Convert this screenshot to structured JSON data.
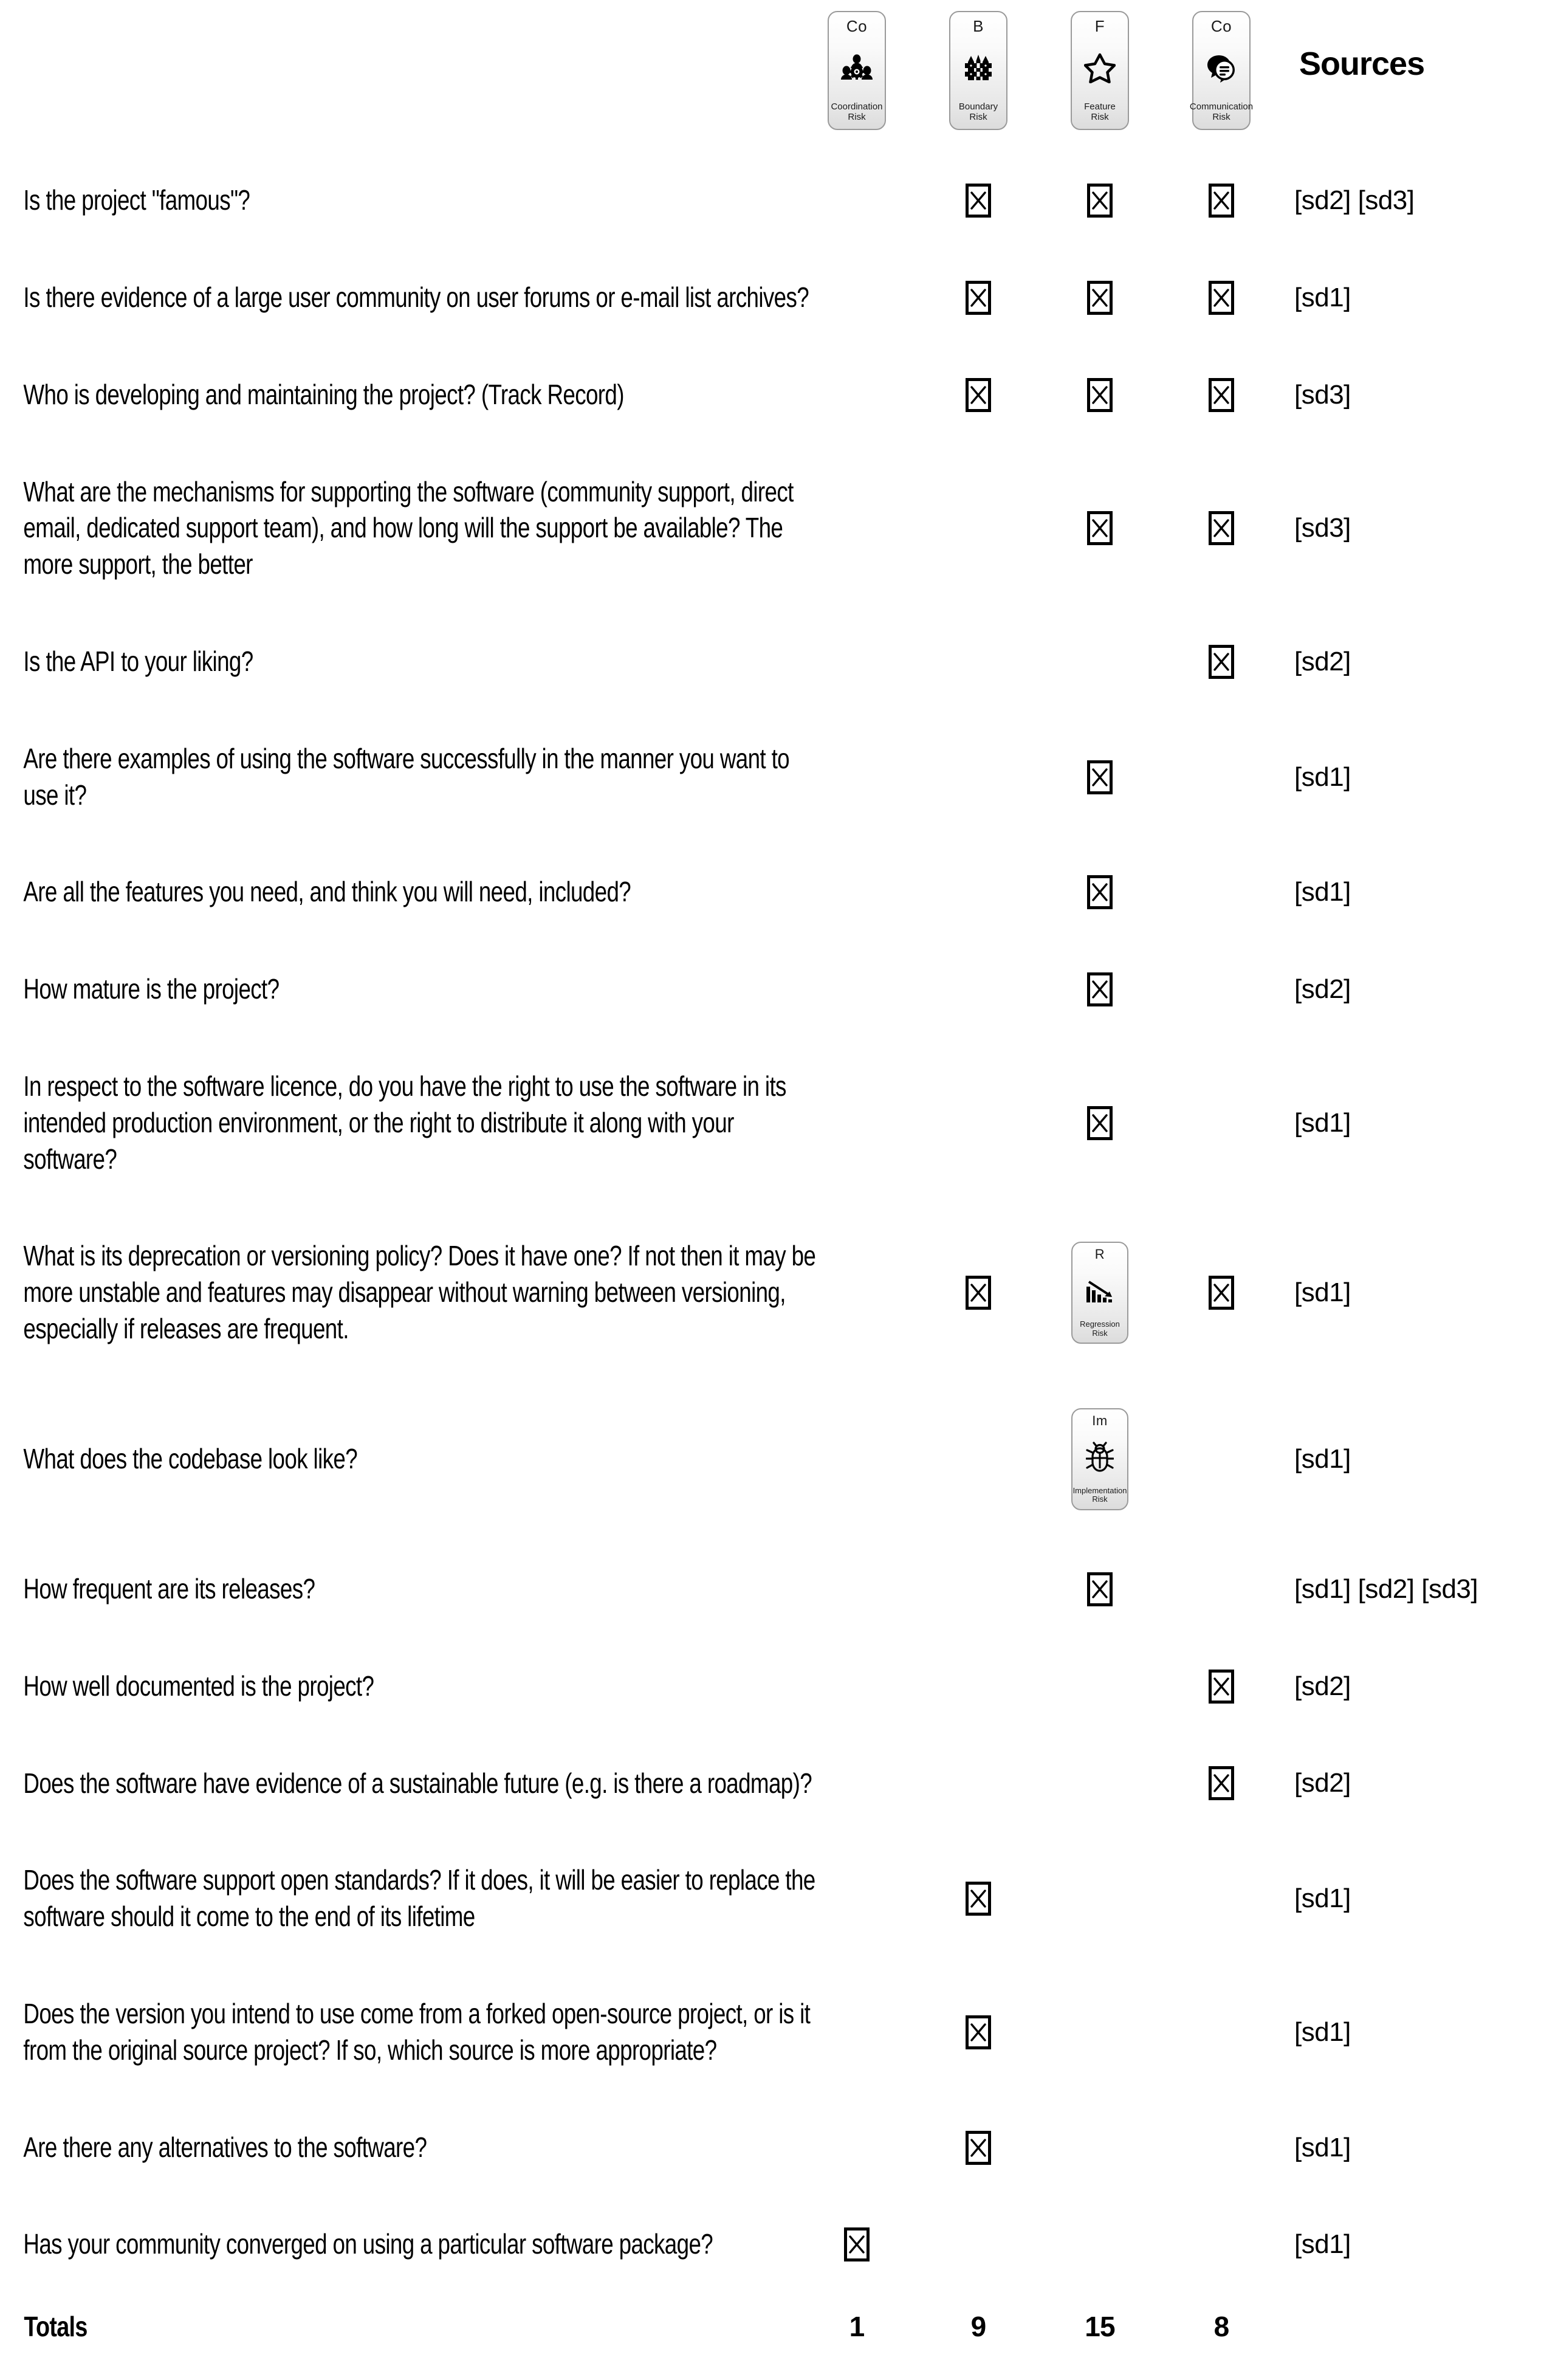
{
  "header": {
    "sources_label": "Sources",
    "risk_columns": [
      {
        "code": "Co",
        "label": "Coordination\nRisk",
        "icon": "people-gear-icon"
      },
      {
        "code": "B",
        "label": "Boundary\nRisk",
        "icon": "fence-icon"
      },
      {
        "code": "F",
        "label": "Feature\nRisk",
        "icon": "star-icon"
      },
      {
        "code": "Co",
        "label": "Communication\nRisk",
        "icon": "speech-bubble-icon"
      }
    ]
  },
  "inline_badges": {
    "regression": {
      "code": "R",
      "label": "Regression\nRisk",
      "icon": "declining-bar-chart-icon"
    },
    "implementation": {
      "code": "Im",
      "label": "Implementation\nRisk",
      "icon": "bug-icon"
    }
  },
  "rows": [
    {
      "question": "Is the project \"famous\"?",
      "marks": [
        "",
        "x",
        "x",
        "x"
      ],
      "sources": "[sd2] [sd3]"
    },
    {
      "question": "Is there evidence of a large user community on user forums or e-mail list archives?",
      "marks": [
        "",
        "x",
        "x",
        "x"
      ],
      "sources": "[sd1]"
    },
    {
      "question": "Who is developing and maintaining the project? (Track Record)",
      "marks": [
        "",
        "x",
        "x",
        "x"
      ],
      "sources": "[sd3]"
    },
    {
      "question": "What are the mechanisms for supporting the software (community support, direct email, dedicated support team), and how long will the support be available? The more support, the better",
      "marks": [
        "",
        "",
        "x",
        "x"
      ],
      "sources": "[sd3]"
    },
    {
      "question": "Is the API to your liking?",
      "marks": [
        "",
        "",
        "",
        "x"
      ],
      "sources": "[sd2]"
    },
    {
      "question": "Are there examples of using the software successfully in the manner you want to use it?",
      "marks": [
        "",
        "",
        "x",
        ""
      ],
      "sources": "[sd1]"
    },
    {
      "question": "Are all the features you need, and think you will need, included?",
      "marks": [
        "",
        "",
        "x",
        ""
      ],
      "sources": "[sd1]"
    },
    {
      "question": "How mature is the project?",
      "marks": [
        "",
        "",
        "x",
        ""
      ],
      "sources": "[sd2]"
    },
    {
      "question": "In respect to the software licence, do you have the right to use the software in its intended production environment, or the right to distribute it along with your software?",
      "marks": [
        "",
        "",
        "x",
        ""
      ],
      "sources": "[sd1]"
    },
    {
      "question": "What is its deprecation or versioning policy? Does it have one? If not then it may be more unstable and features may disappear without warning between versioning, especially if releases are frequent.",
      "marks": [
        "",
        "x",
        "badge:regression",
        "x"
      ],
      "sources": "[sd1]"
    },
    {
      "question": "What does the codebase look like?",
      "marks": [
        "",
        "",
        "badge:implementation",
        ""
      ],
      "sources": "[sd1]"
    },
    {
      "question": "How frequent are its releases?",
      "marks": [
        "",
        "",
        "x",
        ""
      ],
      "sources": "[sd1] [sd2] [sd3]"
    },
    {
      "question": "How well documented is the project?",
      "marks": [
        "",
        "",
        "",
        "x"
      ],
      "sources": "[sd2]"
    },
    {
      "question": "Does the software have evidence of a sustainable future (e.g. is there a roadmap)?",
      "marks": [
        "",
        "",
        "",
        "x"
      ],
      "sources": "[sd2]"
    },
    {
      "question": "Does the software support open standards? If it does, it will be easier to replace the software should it come to the end of its lifetime",
      "marks": [
        "",
        "x",
        "",
        ""
      ],
      "sources": "[sd1]"
    },
    {
      "question": "Does the version you intend to use come from a forked open-source project, or is it from the original source project? If so, which source is more appropriate?",
      "marks": [
        "",
        "x",
        "",
        ""
      ],
      "sources": "[sd1]"
    },
    {
      "question": "Are there any alternatives to the software?",
      "marks": [
        "",
        "x",
        "",
        ""
      ],
      "sources": "[sd1]"
    },
    {
      "question": "Has your community converged on using a particular software package?",
      "marks": [
        "x",
        "",
        "",
        ""
      ],
      "sources": "[sd1]"
    }
  ],
  "totals": {
    "label": "Totals",
    "values": [
      "1",
      "9",
      "15",
      "8"
    ]
  }
}
